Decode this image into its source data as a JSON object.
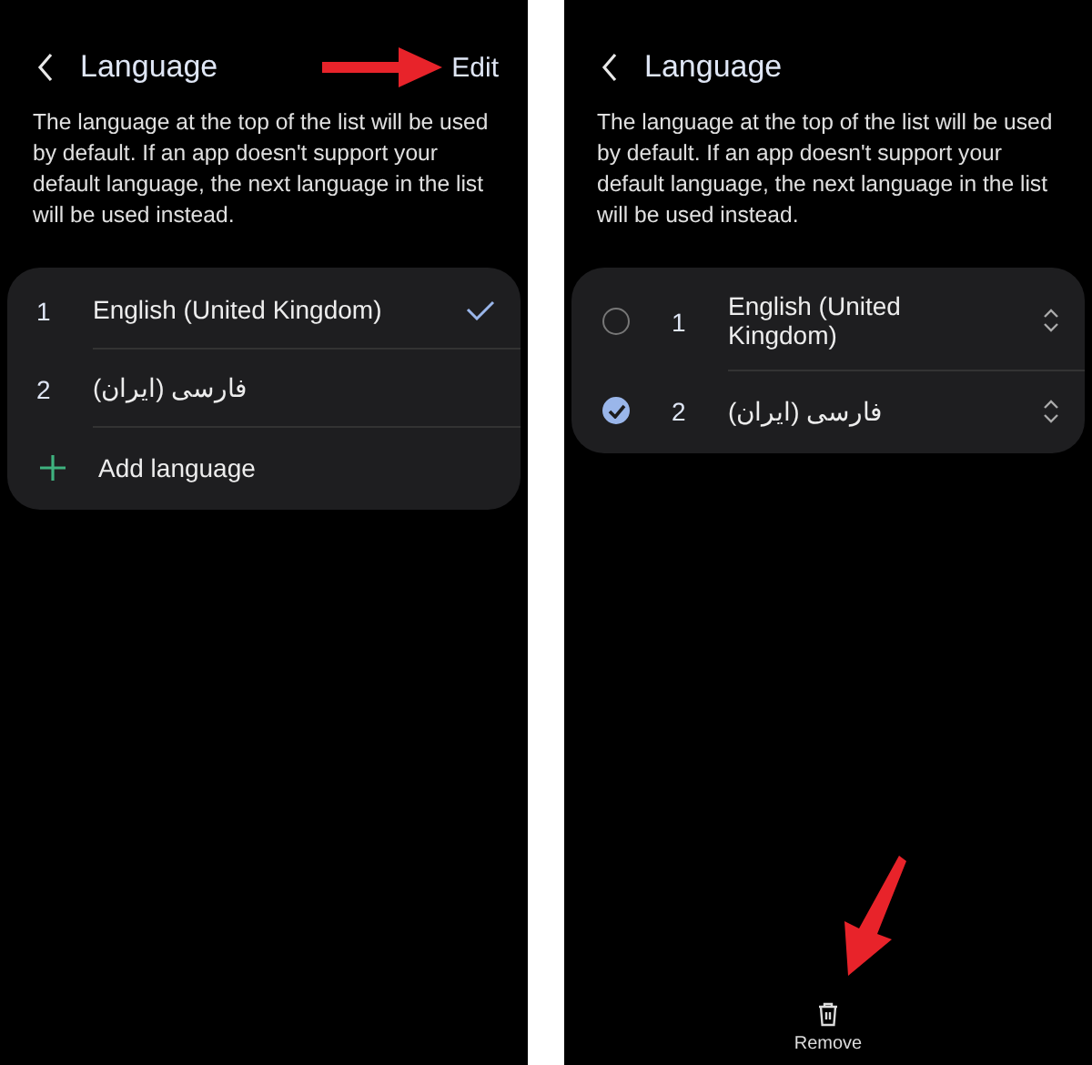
{
  "screens": [
    {
      "kind": "view",
      "title": "Language",
      "action": "Edit",
      "description": "The language at the top of the list will be used by default. If an app doesn't support your default language, the next language in the list will be used instead.",
      "languages": [
        {
          "number": "1",
          "name": "English (United Kingdom)",
          "checked": true
        },
        {
          "number": "2",
          "name": "فارسی (ایران)",
          "checked": false
        }
      ],
      "add_label": "Add language"
    },
    {
      "kind": "edit",
      "title": "Language",
      "description": "The language at the top of the list will be used by default. If an app doesn't support your default language, the next language in the list will be used instead.",
      "languages": [
        {
          "number": "1",
          "name": "English (United Kingdom)",
          "selected": false
        },
        {
          "number": "2",
          "name": "فارسی (ایران)",
          "selected": true
        }
      ],
      "bottom_action": "Remove"
    }
  ]
}
